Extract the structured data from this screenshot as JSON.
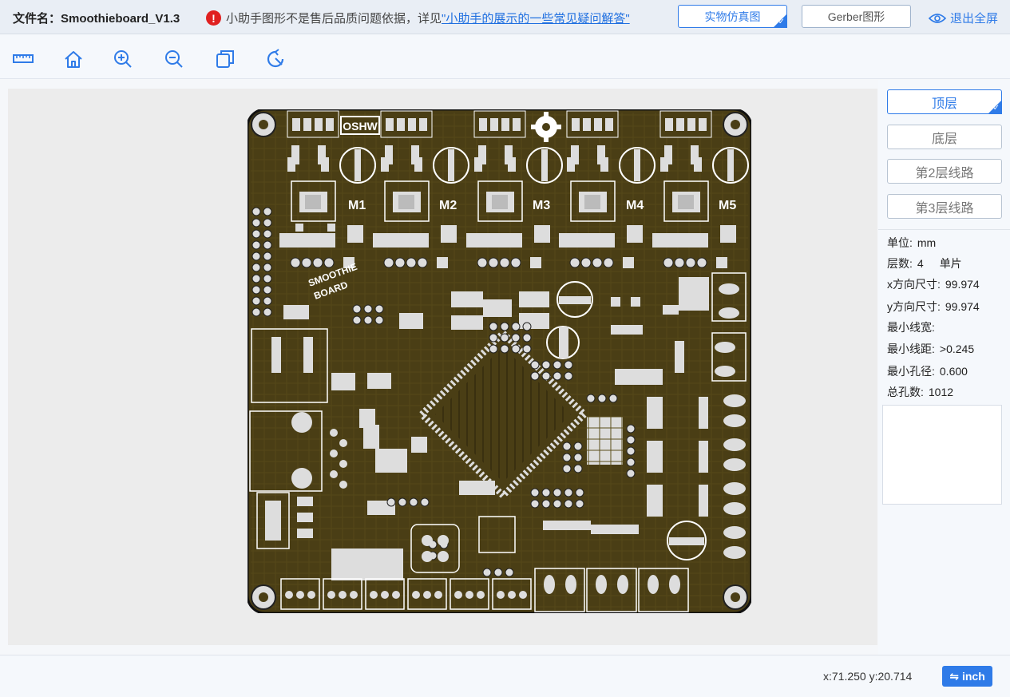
{
  "header": {
    "filename_label": "文件名：",
    "filename": "Smoothieboard_V1.3",
    "notice_text": "小助手图形不是售后品质问题依据，详见",
    "notice_link": "\"小助手的展示的一些常见疑问解答\"",
    "view_real": "实物仿真图",
    "view_gerber": "Gerber图形",
    "exit_fullscreen": "退出全屏"
  },
  "toolbar": {
    "tools": [
      "ruler-icon",
      "home-icon",
      "zoom-in-icon",
      "zoom-out-icon",
      "copy-icon",
      "rotate-icon"
    ]
  },
  "layers": {
    "top": "顶层",
    "bottom": "底层",
    "layer2": "第2层线路",
    "layer3": "第3层线路"
  },
  "info": {
    "unit_label": "单位:",
    "unit": "mm",
    "layers_label": "层数:",
    "layers": "4",
    "panel": "单片",
    "xsize_label": "x方向尺寸:",
    "xsize": "99.974",
    "ysize_label": "y方向尺寸:",
    "ysize": "99.974",
    "minwidth_label": "最小线宽:",
    "minspace_label": "最小线距:",
    "minspace": ">0.245",
    "minhole_label": "最小孔径:",
    "minhole": "0.600",
    "holes_label": "总孔数:",
    "holes": "1012"
  },
  "status": {
    "coords": "x:71.250 y:20.714",
    "unit_toggle": "inch"
  },
  "board": {
    "motor_labels": [
      "M1",
      "M2",
      "M3",
      "M4",
      "M5"
    ],
    "oshw": "OSHW",
    "colors": {
      "pcb": "#4a3e15",
      "copper": "#5c4e1c",
      "silk": "#ffffff",
      "pad": "#dcdcdc"
    }
  },
  "colors": {
    "accent": "#2f7be8",
    "warning": "#e02020"
  }
}
